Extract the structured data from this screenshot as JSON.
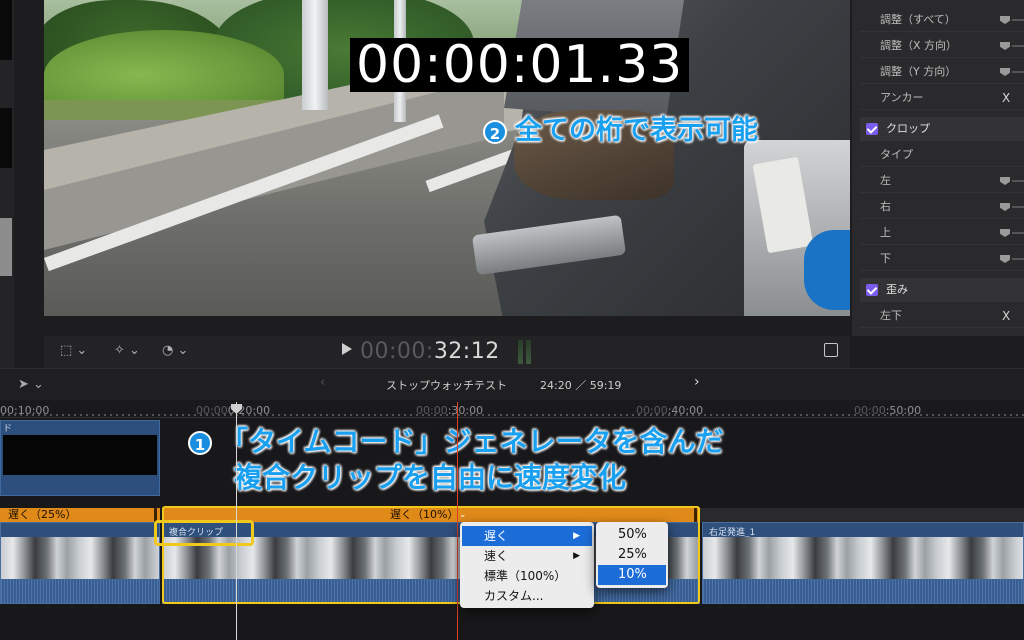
{
  "viewer": {
    "timecode_overlay": "00:00:01.33",
    "playback_timecode_dim": "00:00:",
    "playback_timecode": "32:12"
  },
  "callouts": {
    "c2_badge": "2",
    "c2_text": "全ての桁で表示可能",
    "c1_badge": "1",
    "c1_line1": "「タイムコード」ジェネレータを含んだ",
    "c1_line2": "複合クリップを自由に速度変化"
  },
  "inspector": {
    "rows": [
      {
        "label": "調整（すべて）"
      },
      {
        "label": "調整（X 方向）"
      },
      {
        "label": "調整（Y 方向）"
      }
    ],
    "anchor_label": "アンカー",
    "x_icon": "X",
    "crop": {
      "label": "クロップ",
      "checked": true
    },
    "type_label": "タイプ",
    "crop_rows": [
      "左",
      "右",
      "上",
      "下"
    ],
    "distort": {
      "label": "歪み",
      "checked": true
    },
    "bottom_left_label": "左下"
  },
  "timeline": {
    "project_name": "ストップウォッチテスト",
    "duration": "24:20 ／ 59:19",
    "ruler": [
      {
        "label": "00:10:00",
        "dim": ""
      },
      {
        "dim": "00:00",
        "label": "0:20:00"
      },
      {
        "dim": "00:00",
        "label": ":30:00"
      },
      {
        "dim": "00:00",
        "label": ":40:00"
      },
      {
        "dim": "00:00",
        "label": ":50:00"
      }
    ],
    "upper_clip_label": "ド",
    "speed_left": "遅く（25%）",
    "speed_mid": "遅く（10%）",
    "compound_clip_name": "複合クリップ",
    "right_clip_name": "右足発進_1"
  },
  "menu": {
    "items": [
      "遅く",
      "速く",
      "標準（100%）",
      "カスタム..."
    ],
    "selected": "遅く",
    "submenu": [
      "50%",
      "25%",
      "10%"
    ],
    "submenu_selected": "10%"
  },
  "colors": {
    "accent": "#1c6dd8",
    "speed_bar": "#e08a1a",
    "highlight": "#f2c81a",
    "callout": "#1aa0f0",
    "checkbox": "#7a5cf0"
  }
}
